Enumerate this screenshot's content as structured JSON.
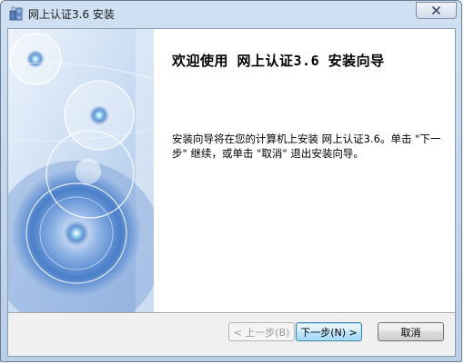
{
  "window": {
    "title": "网上认证3.6 安装"
  },
  "main": {
    "heading": "欢迎使用 网上认证3.6 安装向导",
    "description": "安装向导将在您的计算机上安装 网上认证3.6。单击 \"下一步\" 继续，或单击 \"取消\" 退出安装向导。"
  },
  "buttons": {
    "back": "< 上一步(B)",
    "next": "下一步(N) >",
    "cancel": "取消"
  },
  "colors": {
    "sidebar_accent": "#3a74c4",
    "default_button_border": "#3c7fb1"
  },
  "icons": {
    "app": "installer-icon",
    "close": "close-icon"
  }
}
